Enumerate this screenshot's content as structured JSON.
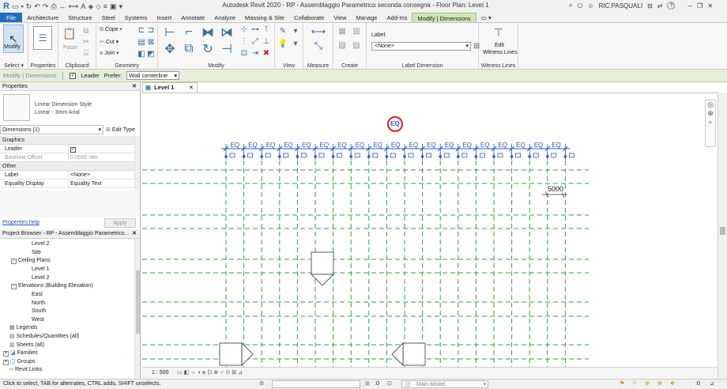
{
  "title_bar": {
    "app_title": "Autodesk Revit 2020 - RP - Assemblaggio Parametrico seconda consegna - Floor Plan: Level 1",
    "user": "RIC.PASQUALI",
    "help": "?"
  },
  "tabs": [
    "File",
    "Architecture",
    "Structure",
    "Steel",
    "Systems",
    "Insert",
    "Annotate",
    "Analyze",
    "Massing & Site",
    "Collaborate",
    "View",
    "Manage",
    "Add-Ins",
    "Modify | Dimensions"
  ],
  "ribbon": {
    "modify_label": "Modify",
    "properties_label": "Properties",
    "paste_label": "Paste",
    "cope_label": "Cope",
    "cut_label": "Cut",
    "join_label": "Join",
    "label_field_caption": "Label:",
    "label_field_value": "<None>",
    "edit_witness_label_1": "Edit",
    "edit_witness_label_2": "Witness Lines",
    "panels": {
      "select": "Select",
      "properties": "Properties",
      "clipboard": "Clipboard",
      "geometry": "Geometry",
      "modify": "Modify",
      "view": "View",
      "measure": "Measure",
      "create": "Create",
      "label_dimension": "Label Dimension",
      "witness_lines": "Witness Lines"
    }
  },
  "options_bar": {
    "context": "Modify | Dimensions",
    "leader_label": "Leader",
    "prefer_label": "Prefer:",
    "prefer_value": "Wall centerline"
  },
  "properties": {
    "header": "Properties",
    "type_name_line1": "Linear Dimension Style",
    "type_name_line2": "Linear - 3mm Arial",
    "selector": "Dimensions (1)",
    "edit_type": "Edit Type",
    "groups": {
      "graphics": "Graphics",
      "other": "Other"
    },
    "rows": {
      "leader": "Leader",
      "baseline_offset": "Baseline Offset",
      "baseline_offset_value": "0.0000 mm",
      "label": "Label",
      "label_value": "<None>",
      "equality_display": "Equality Display",
      "equality_display_value": "Equality Text"
    },
    "help_link": "Properties help",
    "apply": "Apply"
  },
  "project_browser": {
    "header": "Project Browser - RP - Assemblaggio Parametrico...",
    "items": [
      {
        "label": "Level 2"
      },
      {
        "label": "Site"
      },
      {
        "label": "Ceiling Plans"
      },
      {
        "label": "Level 1"
      },
      {
        "label": "Level 2"
      },
      {
        "label": "Elevations (Building Elevation)"
      },
      {
        "label": "East"
      },
      {
        "label": "North"
      },
      {
        "label": "South"
      },
      {
        "label": "West"
      },
      {
        "label": "Legends"
      },
      {
        "label": "Schedules/Quantities (all)"
      },
      {
        "label": "Sheets (all)"
      },
      {
        "label": "Families"
      },
      {
        "label": "Groups"
      },
      {
        "label": "Revit Links"
      }
    ]
  },
  "view": {
    "tab_label": "Level 1",
    "eq_label": "EQ",
    "eq_toggle": "EQ",
    "dimension_value": "5000",
    "scale": "1 : 500"
  },
  "status_bar": {
    "hint": "Click to select, TAB for alternates, CTRL adds, SHIFT unselects.",
    "zero": ":0",
    "model": "Main Model",
    "filter_count": ":0"
  },
  "colors": {
    "grid_green": "#2fa43a",
    "dim_blue": "#2b55c8",
    "eq_highlight": "#d62020",
    "file_tab": "#1f6fb8",
    "options_bg": "#e4eed9"
  }
}
